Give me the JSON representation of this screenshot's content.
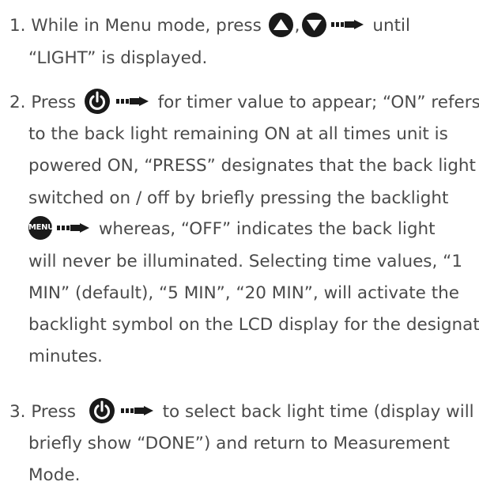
{
  "step1": {
    "line1_pre": "1. While in Menu mode, press ",
    "comma": ",",
    "line1_post": " until",
    "line2": "“LIGHT” is displayed."
  },
  "step2": {
    "line1_pre": "2. Press ",
    "line1_post": " for timer value to appear; “ON” refers",
    "line2": "to the back light remaining ON at all times unit is",
    "line3": "powered ON, “PRESS” designates that the back light is",
    "line4": "switched on / off by briefly pressing the backlight",
    "menu_label": "MENU",
    "line5_post": " whereas, “OFF” indicates the back light",
    "line6": "will never be illuminated. Selecting time values, “1",
    "line7": "MIN” (default), “5 MIN”, “20 MIN”, will activate the",
    "line8": "backlight symbol on the LCD display for the designated",
    "line9": "minutes."
  },
  "step3": {
    "line1_pre": "3. Press ",
    "line1_post": " to select back light time (display will",
    "line2": "briefly show “DONE”) and return to Measurement",
    "line3": "Mode."
  },
  "colors": {
    "text": "#4a4a4a",
    "icon": "#1a1a1a"
  }
}
